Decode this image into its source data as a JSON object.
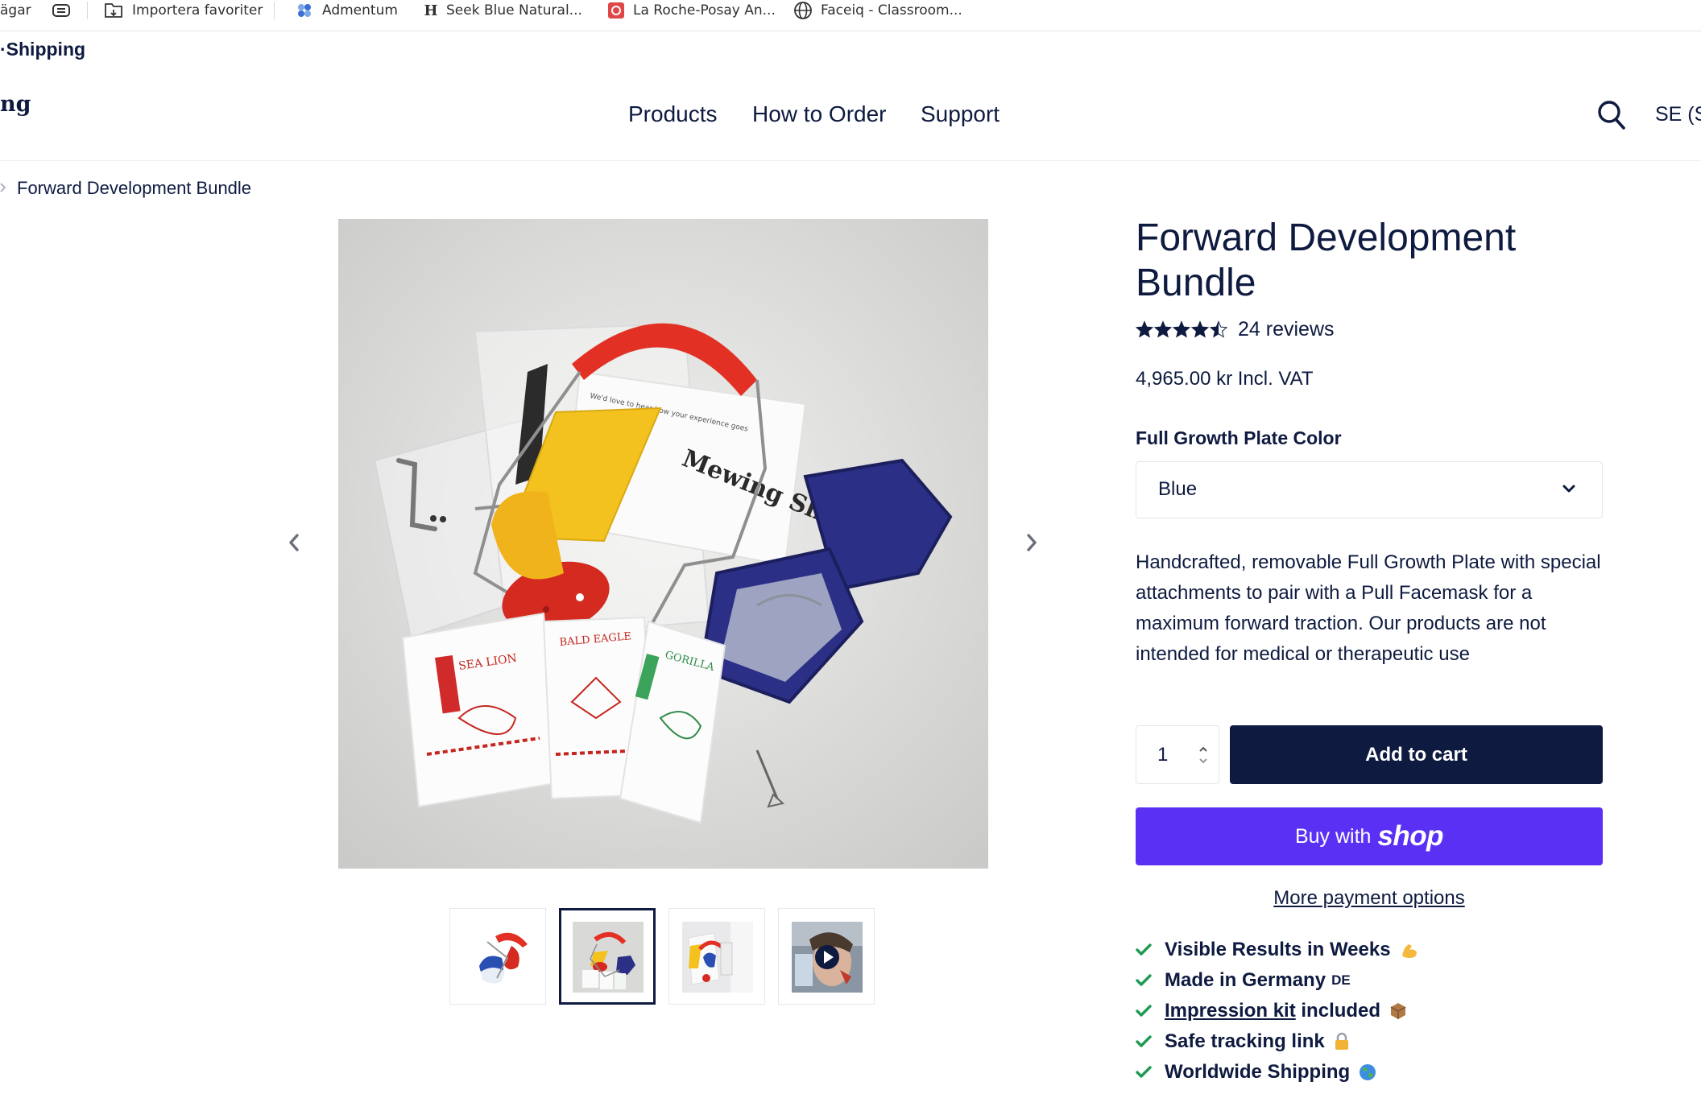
{
  "bookmarks": [
    {
      "label": "ägar",
      "icon": "bookmark-icon"
    },
    {
      "label": "",
      "icon": "tab-icon"
    },
    {
      "label": "Importera favoriter",
      "icon": "import-icon"
    },
    {
      "label": "Admentum",
      "icon": "admentum-icon"
    },
    {
      "label": "Seek Blue Natural...",
      "icon": "letter-h-icon"
    },
    {
      "label": "La Roche-Posay An...",
      "icon": "laroche-icon"
    },
    {
      "label": "Faceiq - Classroom...",
      "icon": "globe-icon"
    }
  ],
  "announcement": "Shipping",
  "announcement_prefix": "·",
  "logo": "ng",
  "nav": [
    "Products",
    "How to Order",
    "Support"
  ],
  "locale": "SE (S",
  "breadcrumb": "Forward Development Bundle",
  "product": {
    "title": "Forward Development Bundle",
    "rating": 4.5,
    "reviews": "24 reviews",
    "price": "4,965.00 kr Incl. VAT",
    "option_label": "Full Growth Plate Color",
    "option_value": "Blue",
    "description": "Handcrafted, removable Full Growth Plate with special attachments to pair with a Pull Facemask for a maximum forward traction. Our products are not intended for medical or therapeutic use",
    "quantity": "1",
    "add_to_cart": "Add to cart",
    "buy_prefix": "Buy with",
    "buy_brand": "shop",
    "more_payment": "More payment options"
  },
  "image_text": {
    "brand": "Mewing Shop",
    "packets": [
      "SEA LION",
      "BALD EAGLE",
      "GORILLA"
    ]
  },
  "features": [
    {
      "text": "Visible Results in Weeks",
      "emoji": "flexed-biceps-icon"
    },
    {
      "text": "Made in Germany",
      "flag": "DE"
    },
    {
      "link": "Impression kit",
      "text": " included",
      "emoji": "package-icon"
    },
    {
      "text": "Safe tracking link",
      "emoji": "lock-icon"
    },
    {
      "text": "Worldwide Shipping",
      "emoji": "globe-icon"
    }
  ],
  "colors": {
    "navy": "#0e1a3f",
    "shop_purple": "#5a31f4",
    "check_green": "#1e9a54"
  }
}
